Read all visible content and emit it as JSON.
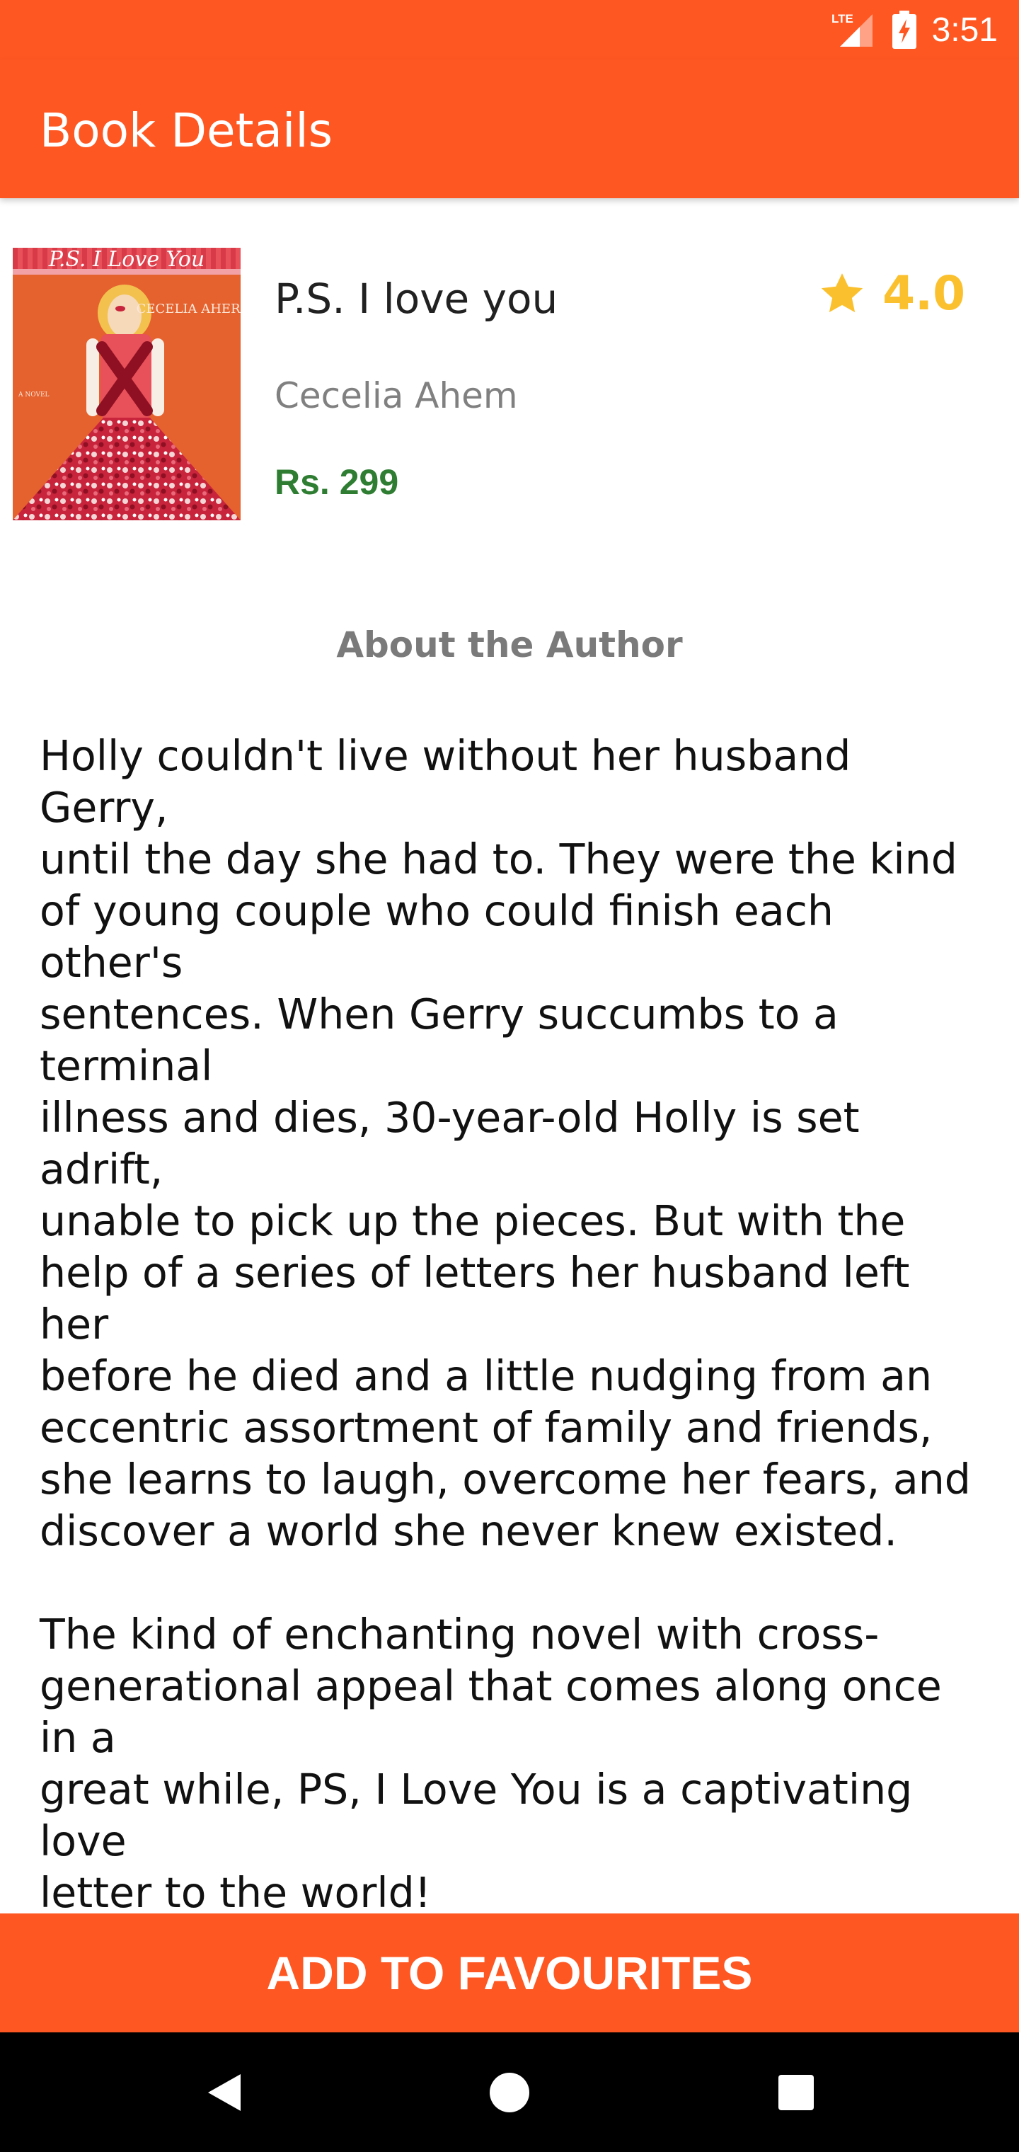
{
  "status_bar": {
    "network_label": "LTE",
    "time": "3:51"
  },
  "app_bar": {
    "title": "Book Details"
  },
  "book": {
    "title": "P.S. I love you",
    "author": "Cecelia Ahem",
    "price": "Rs. 299",
    "rating": "4.0",
    "cover": {
      "title_text": "P.S. I Love You",
      "author_text": "CECELIA AHERN",
      "label_text": "A NOVEL"
    }
  },
  "about": {
    "heading": "About the Author",
    "paragraph_1": "Holly couldn't live without her husband Gerry,\nuntil the day she had to. They were the kind\nof young couple who could finish each other's\nsentences. When Gerry succumbs to a terminal\nillness and dies, 30-year-old Holly is set adrift,\nunable to pick up the pieces. But with the\nhelp of a series of letters her husband left her\nbefore he died and a little nudging from an\neccentric assortment of family and friends,\nshe learns to laugh, overcome her fears, and\ndiscover a world she never knew existed.",
    "paragraph_2": "The kind of enchanting novel with cross-\ngenerational appeal that comes along once in a\ngreat while, PS, I Love You is a captivating love\nletter to the world!"
  },
  "actions": {
    "add_to_favourites": "ADD TO FAVOURITES"
  },
  "icons": {
    "signal": "signal-icon",
    "battery": "battery-charging-icon",
    "rating": "star-icon",
    "nav_back": "back-icon",
    "nav_home": "home-icon",
    "nav_recents": "recents-icon"
  },
  "colors": {
    "primary": "#FF5722",
    "price": "#2E7D32",
    "rating": "#FBC02D"
  }
}
